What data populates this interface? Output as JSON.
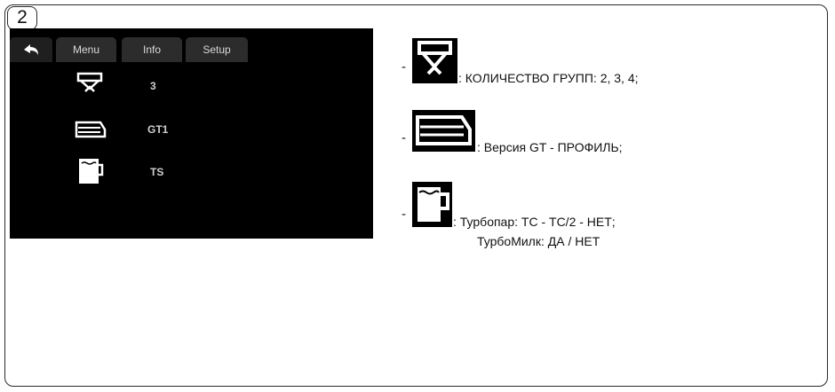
{
  "step_number": "2",
  "screen": {
    "back_icon": "back-arrow-icon",
    "tabs": [
      "Menu",
      "Info",
      "Setup"
    ],
    "rows": [
      {
        "icon": "group-head-icon",
        "value": "3"
      },
      {
        "icon": "boiler-icon",
        "value": "GT1"
      },
      {
        "icon": "milk-jug-icon",
        "value": "TS"
      }
    ]
  },
  "legend": {
    "dash": "-",
    "items": [
      {
        "icon": "group-head-icon",
        "text": ": КОЛИЧЕСТВО ГРУПП: 2, 3, 4;"
      },
      {
        "icon": "boiler-icon",
        "text": ": Версия GT - ПРОФИЛЬ;"
      },
      {
        "icon": "milk-jug-icon",
        "text": ": Турбопар: ТС - ТС/2 - НЕТ;",
        "text2": "ТурбоМилк: ДА / НЕТ"
      }
    ]
  },
  "colors": {
    "screen_bg": "#000000",
    "tab_bg": "#2c2c2c",
    "icon_stroke": "#ffffff",
    "frame": "#2a2a2a"
  }
}
